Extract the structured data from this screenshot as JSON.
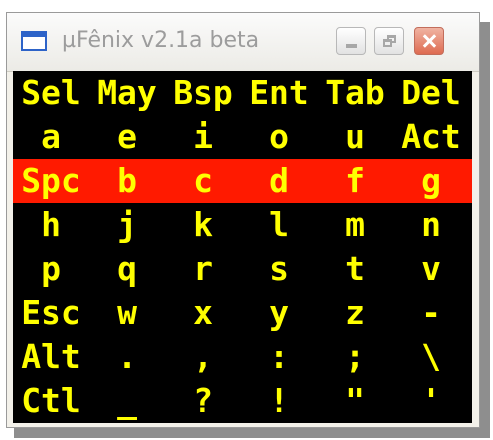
{
  "window": {
    "title": "µFênix v2.1a beta"
  },
  "colors": {
    "key_text": "#ffff00",
    "key_background": "#000000",
    "highlight_row": "#ff1a00"
  },
  "keyboard": {
    "highlighted_row": 2,
    "rows": [
      [
        "Sel",
        "May",
        "Bsp",
        "Ent",
        "Tab",
        "Del"
      ],
      [
        "a",
        "e",
        "i",
        "o",
        "u",
        "Act"
      ],
      [
        "Spc",
        "b",
        "c",
        "d",
        "f",
        "g"
      ],
      [
        "h",
        "j",
        "k",
        "l",
        "m",
        "n"
      ],
      [
        "p",
        "q",
        "r",
        "s",
        "t",
        "v"
      ],
      [
        "Esc",
        "w",
        "x",
        "y",
        "z",
        "-"
      ],
      [
        "Alt",
        ".",
        ",",
        ":",
        ";",
        "\\"
      ],
      [
        "Ctl",
        "_",
        "?",
        "!",
        "\"",
        "'"
      ]
    ]
  }
}
